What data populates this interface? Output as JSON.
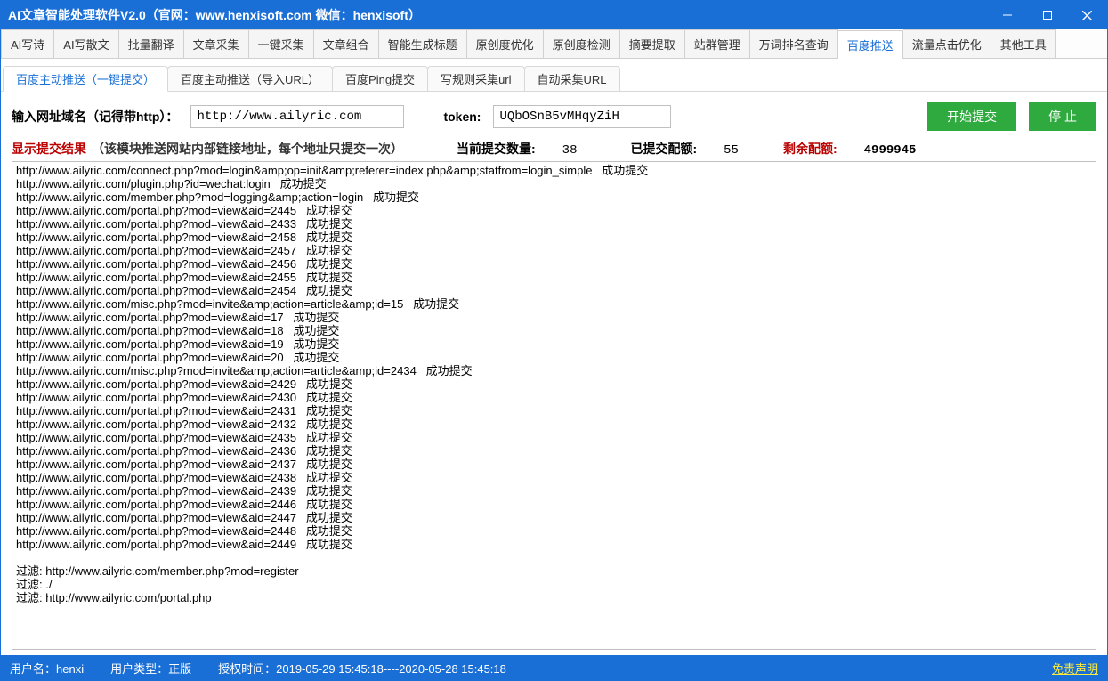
{
  "title": "AI文章智能处理软件V2.0（官网：www.henxisoft.com 微信：henxisoft）",
  "main_tabs": [
    "AI写诗",
    "AI写散文",
    "批量翻译",
    "文章采集",
    "一键采集",
    "文章组合",
    "智能生成标题",
    "原创度优化",
    "原创度检测",
    "摘要提取",
    "站群管理",
    "万词排名查询",
    "百度推送",
    "流量点击优化",
    "其他工具"
  ],
  "main_tab_active": 12,
  "sub_tabs": [
    "百度主动推送（一键提交）",
    "百度主动推送（导入URL）",
    "百度Ping提交",
    "写规则采集url",
    "自动采集URL"
  ],
  "sub_tab_active": 0,
  "inputs": {
    "domain_label": "输入网址域名（记得带http）：",
    "domain_value": "http://www.ailyric.com",
    "token_label": "token:",
    "token_value": "UQbOSnB5vMHqyZiH",
    "start_btn": "开始提交",
    "stop_btn": "停  止"
  },
  "stats": {
    "result_label": "显示提交结果",
    "result_hint": "（该模块推送网站内部链接地址，每个地址只提交一次）",
    "current_label": "当前提交数量:",
    "current_value": "38",
    "submitted_label": "已提交配额:",
    "submitted_value": "55",
    "remain_label": "剩余配额:",
    "remain_value": "4999945"
  },
  "log_lines": [
    "http://www.ailyric.com/connect.php?mod=login&amp;op=init&amp;referer=index.php&amp;statfrom=login_simple   成功提交",
    "http://www.ailyric.com/plugin.php?id=wechat:login   成功提交",
    "http://www.ailyric.com/member.php?mod=logging&amp;action=login   成功提交",
    "http://www.ailyric.com/portal.php?mod=view&aid=2445   成功提交",
    "http://www.ailyric.com/portal.php?mod=view&aid=2433   成功提交",
    "http://www.ailyric.com/portal.php?mod=view&aid=2458   成功提交",
    "http://www.ailyric.com/portal.php?mod=view&aid=2457   成功提交",
    "http://www.ailyric.com/portal.php?mod=view&aid=2456   成功提交",
    "http://www.ailyric.com/portal.php?mod=view&aid=2455   成功提交",
    "http://www.ailyric.com/portal.php?mod=view&aid=2454   成功提交",
    "http://www.ailyric.com/misc.php?mod=invite&amp;action=article&amp;id=15   成功提交",
    "http://www.ailyric.com/portal.php?mod=view&aid=17   成功提交",
    "http://www.ailyric.com/portal.php?mod=view&aid=18   成功提交",
    "http://www.ailyric.com/portal.php?mod=view&aid=19   成功提交",
    "http://www.ailyric.com/portal.php?mod=view&aid=20   成功提交",
    "http://www.ailyric.com/misc.php?mod=invite&amp;action=article&amp;id=2434   成功提交",
    "http://www.ailyric.com/portal.php?mod=view&aid=2429   成功提交",
    "http://www.ailyric.com/portal.php?mod=view&aid=2430   成功提交",
    "http://www.ailyric.com/portal.php?mod=view&aid=2431   成功提交",
    "http://www.ailyric.com/portal.php?mod=view&aid=2432   成功提交",
    "http://www.ailyric.com/portal.php?mod=view&aid=2435   成功提交",
    "http://www.ailyric.com/portal.php?mod=view&aid=2436   成功提交",
    "http://www.ailyric.com/portal.php?mod=view&aid=2437   成功提交",
    "http://www.ailyric.com/portal.php?mod=view&aid=2438   成功提交",
    "http://www.ailyric.com/portal.php?mod=view&aid=2439   成功提交",
    "http://www.ailyric.com/portal.php?mod=view&aid=2446   成功提交",
    "http://www.ailyric.com/portal.php?mod=view&aid=2447   成功提交",
    "http://www.ailyric.com/portal.php?mod=view&aid=2448   成功提交",
    "http://www.ailyric.com/portal.php?mod=view&aid=2449   成功提交"
  ],
  "filter_lines": [
    "过滤: http://www.ailyric.com/member.php?mod=register",
    "过滤: ./",
    "过滤: http://www.ailyric.com/portal.php"
  ],
  "status": {
    "user_label": "用户名：",
    "user_value": "henxi",
    "type_label": "用户类型：",
    "type_value": "正版",
    "auth_label": "授权时间：",
    "auth_value": "2019-05-29 15:45:18----2020-05-28 15:45:18",
    "disclaimer": "免责声明"
  }
}
